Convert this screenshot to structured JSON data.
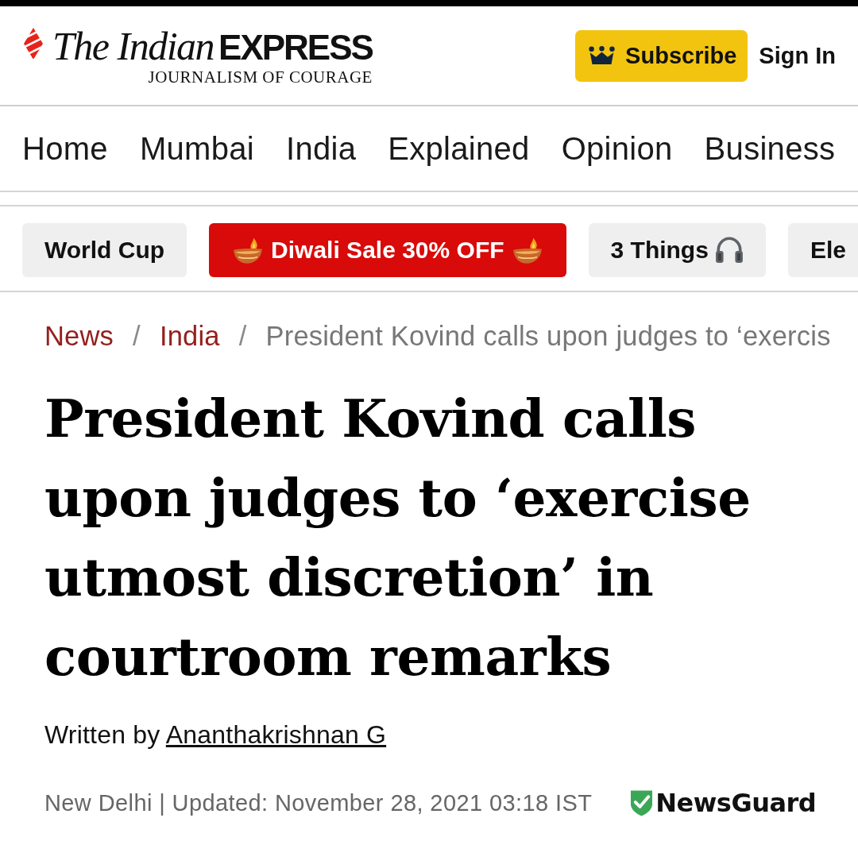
{
  "header": {
    "logo": {
      "title_italic": "The Indian",
      "title_bold": "EXPRESS",
      "tagline": "JOURNALISM OF COURAGE"
    },
    "subscribe_button": "Subscribe",
    "sign_in": "Sign In"
  },
  "nav": {
    "items": [
      "Home",
      "Mumbai",
      "India",
      "Explained",
      "Opinion",
      "Business"
    ]
  },
  "pills": [
    {
      "label": "World Cup",
      "kind": "plain"
    },
    {
      "label": "Diwali Sale 30% OFF",
      "kind": "promo"
    },
    {
      "label": "3 Things",
      "kind": "audio"
    },
    {
      "label": "Ele",
      "kind": "plain"
    }
  ],
  "breadcrumb": [
    {
      "label": "News",
      "kind": "link"
    },
    {
      "label": "/",
      "kind": "separator"
    },
    {
      "label": "India",
      "kind": "link"
    },
    {
      "label": "/",
      "kind": "separator"
    },
    {
      "label": "President Kovind calls upon judges to ‘exercis",
      "kind": "current"
    }
  ],
  "article": {
    "headline": "President Kovind calls upon judges to ‘exercise utmost discretion’ in courtroom remarks",
    "byline": {
      "prefix": "Written by",
      "author": "Ananthakrishnan G"
    },
    "dateline": "New Delhi | Updated: November 28, 2021 03:18 IST",
    "badge": "NewsGuard"
  }
}
